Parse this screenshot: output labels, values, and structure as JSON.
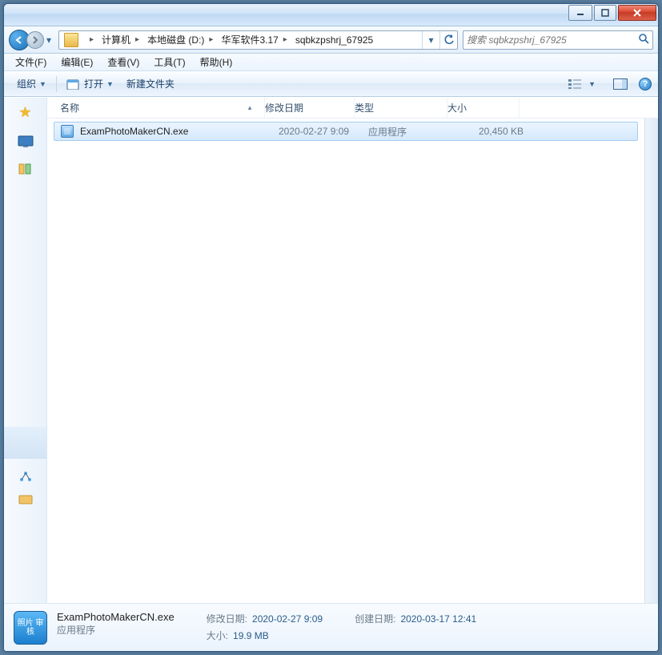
{
  "window_controls": {
    "minimize": "minimize",
    "maximize": "maximize",
    "close": "close"
  },
  "breadcrumb": {
    "items": [
      {
        "label": "计算机"
      },
      {
        "label": "本地磁盘 (D:)"
      },
      {
        "label": "华军软件3.17"
      },
      {
        "label": "sqbkzpshrj_67925"
      }
    ]
  },
  "search": {
    "placeholder": "搜索 sqbkzpshrj_67925"
  },
  "menubar": {
    "file": "文件(F)",
    "edit": "编辑(E)",
    "view": "查看(V)",
    "tools": "工具(T)",
    "help": "帮助(H)"
  },
  "toolbar": {
    "organize": "组织",
    "open": "打开",
    "newfolder": "新建文件夹"
  },
  "columns": {
    "name": "名称",
    "date": "修改日期",
    "type": "类型",
    "size": "大小"
  },
  "files": [
    {
      "name": "ExamPhotoMakerCN.exe",
      "date": "2020-02-27 9:09",
      "type": "应用程序",
      "size": "20,450 KB",
      "selected": true
    }
  ],
  "details": {
    "icon_text": "照片\n审核",
    "name": "ExamPhotoMakerCN.exe",
    "subtitle": "应用程序",
    "modified_label": "修改日期:",
    "modified_value": "2020-02-27 9:09",
    "size_label": "大小:",
    "size_value": "19.9 MB",
    "created_label": "创建日期:",
    "created_value": "2020-03-17 12:41"
  }
}
